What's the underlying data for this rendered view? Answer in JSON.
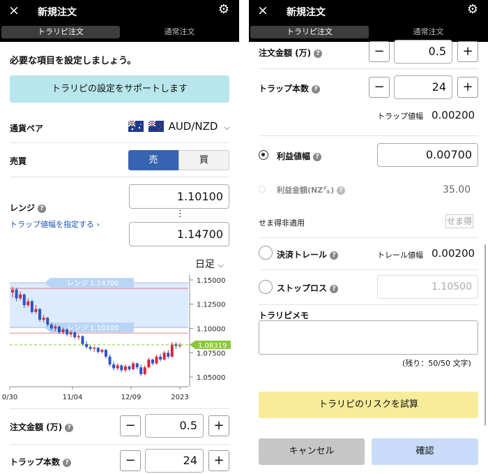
{
  "header": {
    "close_icon": "×",
    "title": "新規注文",
    "settings_icon": "⚙"
  },
  "tabs": [
    {
      "label": "トラリピ注文",
      "active": true
    },
    {
      "label": "通常注文",
      "active": false
    }
  ],
  "left": {
    "intro": "必要な項目を設定しましょう。",
    "support_button": "トラリピの設定をサポートします",
    "currency_label": "通貨ペア",
    "currency_value": "AUD/NZD",
    "side_label": "売買",
    "sell": "売",
    "buy": "買",
    "range_label": "レンジ",
    "range_upper": "1.10100",
    "range_lower": "1.14700",
    "range_dots": "⋮",
    "trap_link": "トラップ値幅を指定する ›",
    "timeframe": "日足",
    "order_amount_label": "注文金額 (万)",
    "order_amount": "0.5",
    "trap_count_label": "トラップ本数",
    "trap_count": "24",
    "minus": "−",
    "plus": "+"
  },
  "chart_data": {
    "type": "candlestick",
    "x_ticks": [
      "0/30",
      "11/04",
      "12/09",
      "2023"
    ],
    "y_ticks": [
      "1.15000",
      "1.12500",
      "1.10000",
      "1.07500",
      "1.05000"
    ],
    "ylim": [
      1.04,
      1.155
    ],
    "range_high": {
      "label": "レンジ 1.14700",
      "value": 1.147
    },
    "range_low": {
      "label": "レンジ 1.10100",
      "value": 1.101
    },
    "current_price": {
      "label": "1.08319",
      "value": 1.08319
    },
    "candles": [
      {
        "o": 1.137,
        "h": 1.143,
        "l": 1.132,
        "c": 1.14
      },
      {
        "o": 1.14,
        "h": 1.142,
        "l": 1.128,
        "c": 1.131
      },
      {
        "o": 1.131,
        "h": 1.138,
        "l": 1.129,
        "c": 1.135
      },
      {
        "o": 1.135,
        "h": 1.136,
        "l": 1.121,
        "c": 1.124
      },
      {
        "o": 1.124,
        "h": 1.131,
        "l": 1.122,
        "c": 1.128
      },
      {
        "o": 1.128,
        "h": 1.13,
        "l": 1.115,
        "c": 1.117
      },
      {
        "o": 1.117,
        "h": 1.124,
        "l": 1.115,
        "c": 1.12
      },
      {
        "o": 1.12,
        "h": 1.121,
        "l": 1.107,
        "c": 1.109
      },
      {
        "o": 1.109,
        "h": 1.114,
        "l": 1.106,
        "c": 1.111
      },
      {
        "o": 1.111,
        "h": 1.112,
        "l": 1.102,
        "c": 1.104
      },
      {
        "o": 1.104,
        "h": 1.106,
        "l": 1.098,
        "c": 1.1
      },
      {
        "o": 1.1,
        "h": 1.104,
        "l": 1.097,
        "c": 1.102
      },
      {
        "o": 1.102,
        "h": 1.103,
        "l": 1.094,
        "c": 1.096
      },
      {
        "o": 1.096,
        "h": 1.101,
        "l": 1.094,
        "c": 1.099
      },
      {
        "o": 1.099,
        "h": 1.1,
        "l": 1.092,
        "c": 1.094
      },
      {
        "o": 1.094,
        "h": 1.098,
        "l": 1.091,
        "c": 1.096
      },
      {
        "o": 1.096,
        "h": 1.097,
        "l": 1.089,
        "c": 1.091
      },
      {
        "o": 1.091,
        "h": 1.094,
        "l": 1.088,
        "c": 1.092
      },
      {
        "o": 1.092,
        "h": 1.093,
        "l": 1.082,
        "c": 1.084
      },
      {
        "o": 1.084,
        "h": 1.087,
        "l": 1.079,
        "c": 1.081
      },
      {
        "o": 1.081,
        "h": 1.083,
        "l": 1.077,
        "c": 1.079
      },
      {
        "o": 1.079,
        "h": 1.082,
        "l": 1.076,
        "c": 1.08
      },
      {
        "o": 1.08,
        "h": 1.081,
        "l": 1.074,
        "c": 1.076
      },
      {
        "o": 1.076,
        "h": 1.079,
        "l": 1.074,
        "c": 1.078
      },
      {
        "o": 1.078,
        "h": 1.079,
        "l": 1.069,
        "c": 1.071
      },
      {
        "o": 1.071,
        "h": 1.073,
        "l": 1.061,
        "c": 1.063
      },
      {
        "o": 1.063,
        "h": 1.066,
        "l": 1.057,
        "c": 1.059
      },
      {
        "o": 1.059,
        "h": 1.064,
        "l": 1.057,
        "c": 1.062
      },
      {
        "o": 1.062,
        "h": 1.063,
        "l": 1.055,
        "c": 1.057
      },
      {
        "o": 1.057,
        "h": 1.063,
        "l": 1.055,
        "c": 1.061
      },
      {
        "o": 1.061,
        "h": 1.062,
        "l": 1.056,
        "c": 1.058
      },
      {
        "o": 1.058,
        "h": 1.066,
        "l": 1.057,
        "c": 1.064
      },
      {
        "o": 1.064,
        "h": 1.065,
        "l": 1.058,
        "c": 1.06
      },
      {
        "o": 1.06,
        "h": 1.063,
        "l": 1.051,
        "c": 1.053
      },
      {
        "o": 1.053,
        "h": 1.062,
        "l": 1.052,
        "c": 1.06
      },
      {
        "o": 1.06,
        "h": 1.07,
        "l": 1.059,
        "c": 1.068
      },
      {
        "o": 1.068,
        "h": 1.069,
        "l": 1.062,
        "c": 1.064
      },
      {
        "o": 1.064,
        "h": 1.073,
        "l": 1.063,
        "c": 1.071
      },
      {
        "o": 1.071,
        "h": 1.074,
        "l": 1.066,
        "c": 1.068
      },
      {
        "o": 1.068,
        "h": 1.077,
        "l": 1.067,
        "c": 1.075
      },
      {
        "o": 1.075,
        "h": 1.078,
        "l": 1.069,
        "c": 1.071
      },
      {
        "o": 1.071,
        "h": 1.086,
        "l": 1.07,
        "c": 1.084
      },
      {
        "o": 1.084,
        "h": 1.086,
        "l": 1.079,
        "c": 1.082
      },
      {
        "o": 1.082,
        "h": 1.085,
        "l": 1.08,
        "c": 1.083
      }
    ]
  },
  "right": {
    "order_amount_label": "注文金額 (万)",
    "order_amount": "0.5",
    "trap_count_label": "トラップ本数",
    "trap_count": "24",
    "trap_width_label": "トラップ値幅",
    "trap_width": "0.00200",
    "profit_width_label": "利益値幅",
    "profit_width": "0.00700",
    "profit_amount_label": "利益金額(NZ㌦)",
    "profit_amount": "35.00",
    "semae_label": "せま得非適用",
    "semae_logo": "せま得",
    "trail_label": "決済トレール",
    "trail_width_label": "トレール値幅",
    "trail_width": "0.00200",
    "stoploss_label": "ストップロス",
    "stoploss_placeholder": "1.10500",
    "memo_label": "トラリピメモ",
    "memo_remaining": "(残り：50/50 文字)",
    "risk_button": "トラリピのリスクを試算",
    "cancel_button": "キャンセル",
    "confirm_button": "確認",
    "minus": "−",
    "plus": "+"
  },
  "colors": {
    "sell": "#3764b0",
    "support": "#b7e7ec",
    "risk": "#f8ec9a",
    "confirm": "#c8dbf8",
    "cancel": "#c6c6c6",
    "up": "#d6283a",
    "down": "#2e54c8",
    "price": "#8cc63f",
    "range_fill": "#dcebfd"
  }
}
